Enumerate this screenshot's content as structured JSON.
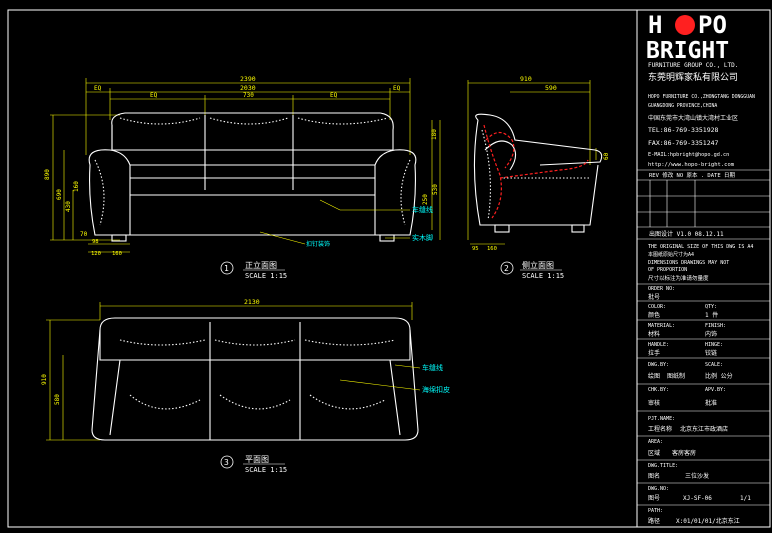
{
  "brand": {
    "logo_left": "H",
    "logo_o": "O",
    "logo_right": "PO",
    "logo_line2": "BRIGHT",
    "group": "FURNITURE GROUP CO., LTD.",
    "company_cn": "东莞明辉家私有限公司"
  },
  "contact": {
    "address_en": [
      "HOPO FURNITURE CO.,ZHONGTANG DONGGUAN",
      "GUANGDONG PROVINCE,CHINA"
    ],
    "address_cn": "中国东莞市大湾山镇大湾村工业区",
    "tel": "TEL:86-769-3351928",
    "fax": "FAX:86-769-3351247",
    "email": "E-MAIL:hpbright@hopo.gd.cn",
    "web": "http://www.hopo-bright.com"
  },
  "title_block": {
    "revision_header": "REV 修改  NO 原本 .  DATE 日期",
    "drawn_row": "出图设计   V1.0   08.12.11",
    "notes": [
      "THE ORIGINAL SIZE OF THIS DWG IS A4",
      "本图纸原始尺寸为A4",
      "DIMENSIONS DRAWINGS MAY NOT",
      "OF PROPORTION",
      "尺寸以标注为准请勿量度"
    ],
    "fields": [
      {
        "label_en": "ORDER NO:",
        "label_cn": "批号",
        "value": "",
        "label2": "",
        "value2": ""
      },
      {
        "label_en": "COLOR:",
        "label_cn": "颜色",
        "value": "",
        "label2": "QTY:",
        "value2": "1 件"
      },
      {
        "label_en": "MATERIAL:",
        "label_cn": "材料",
        "value": "",
        "label2": "FINISH:",
        "value2": "内饰"
      },
      {
        "label_en": "HANDLE:",
        "label_cn": "拉手",
        "value": "",
        "label2": "HINGE:",
        "value2": "铰链"
      },
      {
        "label_en": "DWG.BY:",
        "label_cn": "绘图",
        "value": "图纸制",
        "label2": "SCALE:",
        "value2": "比例   公分"
      },
      {
        "label_en": "CHK.BY:",
        "label_cn": "审核",
        "value": "",
        "label2": "APV.BY:",
        "value2": "批准"
      },
      {
        "label_en": "PJT.NAME:",
        "label_cn": "工程名称",
        "value": "北京东江市政酒店",
        "label2": "",
        "value2": ""
      },
      {
        "label_en": "AREA:",
        "label_cn": "区域",
        "value": "客房客房",
        "label2": "",
        "value2": ""
      },
      {
        "label_en": "DWG.TITLE:",
        "label_cn": "图名",
        "value": "三位沙发",
        "label2": "",
        "value2": ""
      },
      {
        "label_en": "DWG.NO:",
        "label_cn": "图号",
        "value": "XJ-SF-06",
        "label2": "",
        "value2": "1/1"
      },
      {
        "label_en": "PATH:",
        "label_cn": "路径",
        "value": "X:01/01/01/北京东江",
        "label2": "",
        "value2": ""
      }
    ]
  },
  "front_view": {
    "number": "1",
    "title": "正立面图",
    "scale": "SCALE 1:15",
    "dims_top": [
      "2390",
      "2030",
      "EQ",
      "EQ",
      "EQ",
      "730",
      "EQ"
    ],
    "dims_left": [
      "890",
      "690",
      "430",
      "160",
      "70"
    ],
    "dims_right": [
      "180",
      "530",
      "250"
    ],
    "dims_bottom": [
      "98",
      "120",
      "160"
    ],
    "labels": [
      "车缝线",
      "实木脚",
      "扣钉装饰"
    ]
  },
  "side_view": {
    "number": "2",
    "title": "侧立面图",
    "scale": "SCALE 1:15",
    "dims": [
      "910",
      "590",
      "60",
      "95",
      "160"
    ]
  },
  "plan_view": {
    "number": "3",
    "title": "平面图",
    "scale": "SCALE 1:15",
    "dims": [
      "2130",
      "910",
      "580"
    ],
    "labels": [
      "车缝线",
      "海绵扣皮"
    ]
  }
}
